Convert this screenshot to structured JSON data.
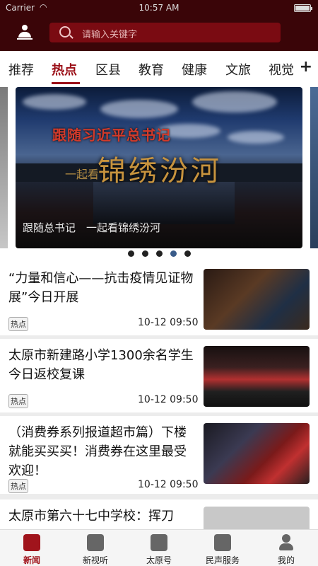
{
  "status_bar": {
    "carrier": "Carrier",
    "time": "10:57 AM"
  },
  "search": {
    "placeholder": "请输入关键字"
  },
  "tabs": [
    {
      "label": "推荐"
    },
    {
      "label": "热点"
    },
    {
      "label": "区县"
    },
    {
      "label": "教育"
    },
    {
      "label": "健康"
    },
    {
      "label": "文旅"
    },
    {
      "label": "视觉"
    }
  ],
  "active_tab": "热点",
  "carousel": {
    "banner_title": "跟随习近平总书记",
    "banner_subtitle_small": "一起看",
    "banner_subtitle_large": "锦绣汾河",
    "caption": "跟随总书记　一起看锦绣汾河",
    "dot_count": 5,
    "active_dot": 4
  },
  "news": [
    {
      "title": "“力量和信心——抗击疫情见证物展”今日开展",
      "tag": "热点",
      "time": "10-12 09:50"
    },
    {
      "title": "太原市新建路小学1300余名学生今日返校复课",
      "tag": "热点",
      "time": "10-12 09:50"
    },
    {
      "title": "（消费券系列报道超市篇）下楼就能买买买！消费券在这里最受欢迎！",
      "tag": "热点",
      "time": "10-12 09:50"
    },
    {
      "title": "太原市第六十七中学校：挥刀",
      "tag": "",
      "time": ""
    }
  ],
  "bottom_nav": [
    {
      "label": "新闻",
      "icon": "news-icon"
    },
    {
      "label": "新视听",
      "icon": "video-icon"
    },
    {
      "label": "太原号",
      "icon": "account-icon"
    },
    {
      "label": "民声服务",
      "icon": "cart-icon"
    },
    {
      "label": "我的",
      "icon": "person-icon"
    }
  ],
  "colors": {
    "header_bg": "#3a0508",
    "accent": "#9b1018",
    "search_bg": "#7a0b12"
  }
}
